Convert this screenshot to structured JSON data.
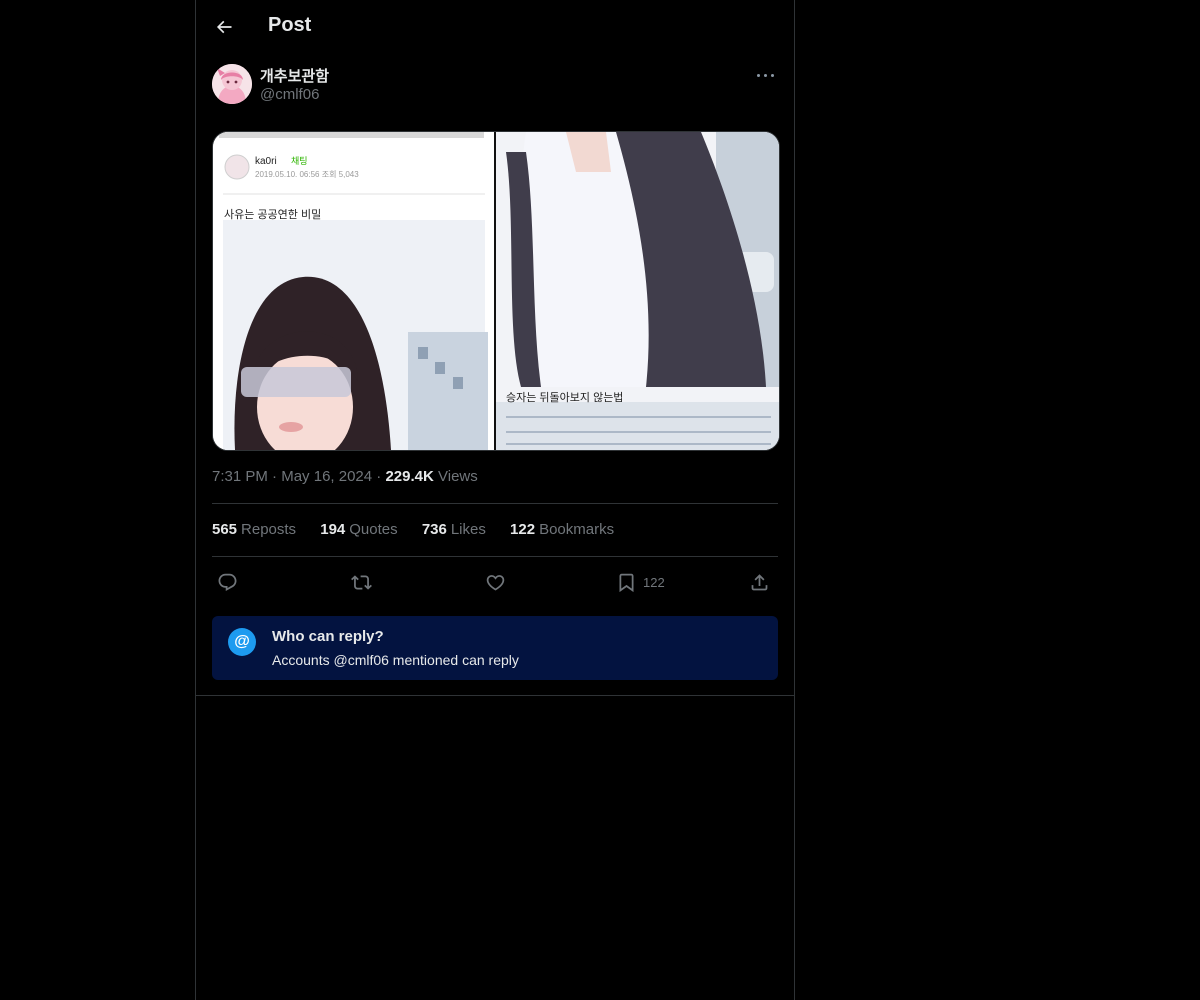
{
  "header": {
    "title": "Post"
  },
  "author": {
    "display_name": "개추보관함",
    "handle": "@cmlf06"
  },
  "media": {
    "left": {
      "caption_top": "사유는 공공연한 비밀",
      "user": "ka0ri",
      "badge": "채팅",
      "meta": "2019.05.10. 06:56  조회 5,043"
    },
    "right": {
      "caption": "승자는 뒤돌아보지 않는법"
    }
  },
  "post_meta": {
    "time": "7:31 PM",
    "dot1": "·",
    "date": "May 16, 2024",
    "dot2": "·",
    "views_count": "229.4K",
    "views_label": "Views"
  },
  "stats": [
    {
      "count": "565",
      "label": "Reposts"
    },
    {
      "count": "194",
      "label": "Quotes"
    },
    {
      "count": "736",
      "label": "Likes"
    },
    {
      "count": "122",
      "label": "Bookmarks"
    }
  ],
  "actions": {
    "reply_icon": "reply-icon",
    "repost_icon": "repost-icon",
    "like_icon": "heart-icon",
    "bookmark_icon": "bookmark-icon",
    "bookmark_count": "122",
    "share_icon": "share-icon"
  },
  "reply_restriction": {
    "symbol": "@",
    "title": "Who can reply?",
    "subtitle": "Accounts @cmlf06 mentioned can reply"
  },
  "colors": {
    "background": "#000000",
    "accent": "#1d9bf0",
    "muted": "#71767b",
    "reply_box": "#031340"
  }
}
